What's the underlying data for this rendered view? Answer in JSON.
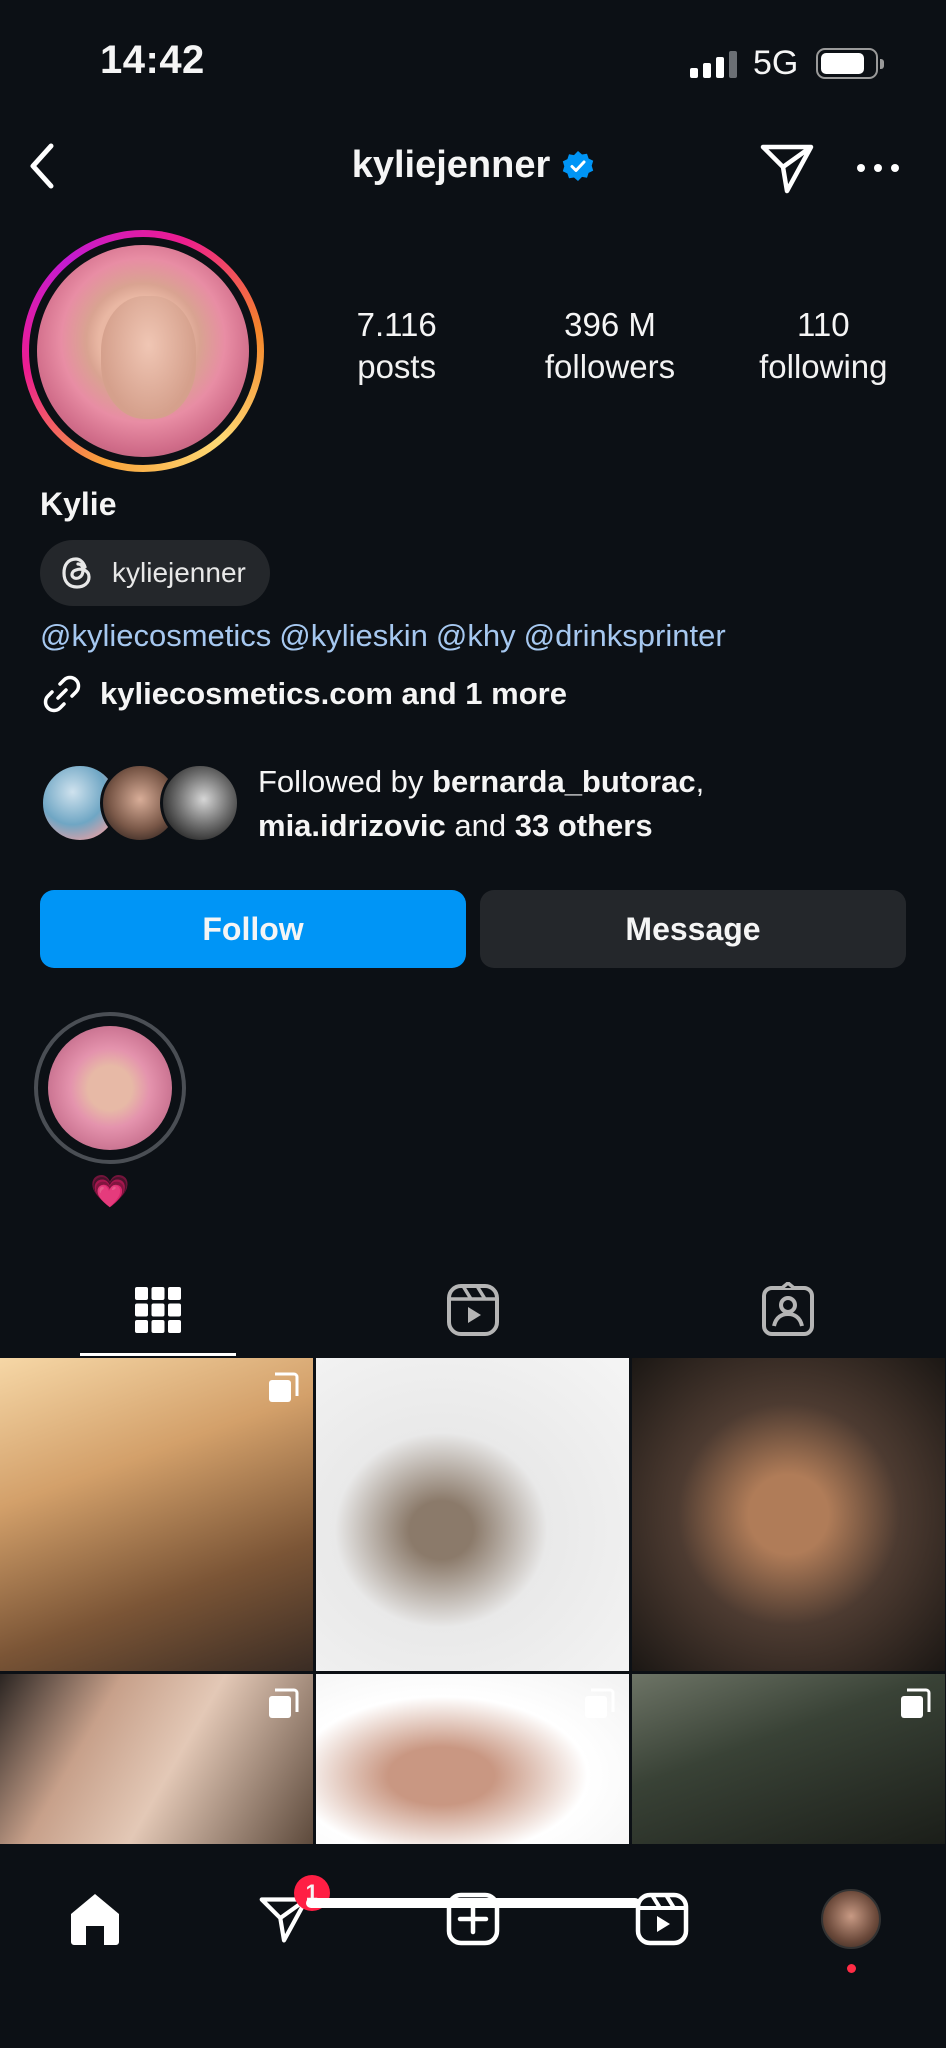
{
  "status": {
    "time": "14:42",
    "network": "5G"
  },
  "header": {
    "username": "kyliejenner"
  },
  "profile": {
    "stats": [
      {
        "num": "7.116",
        "label": "posts"
      },
      {
        "num": "396 M",
        "label": "followers"
      },
      {
        "num": "110",
        "label": "following"
      }
    ],
    "name": "Kylie",
    "threads_handle": "kyliejenner",
    "mentions": [
      "@kyliecosmetics",
      "@kylieskin",
      "@khy",
      "@drinksprinter"
    ],
    "link": "kyliecosmetics.com and 1 more",
    "followed_by": {
      "prefix": "Followed by ",
      "user1": "bernarda_butorac",
      "comma": ",",
      "user2": "mia.idrizovic",
      "middle": " and ",
      "others": "33 others"
    }
  },
  "actions": {
    "follow": "Follow",
    "message": "Message"
  },
  "highlight": {
    "label": "💗"
  },
  "nav": {
    "badge": "1"
  },
  "colors": {
    "accent": "#0095f6",
    "background": "#0c1015",
    "mention": "#a6c8f0",
    "badge": "#ff1f44"
  }
}
